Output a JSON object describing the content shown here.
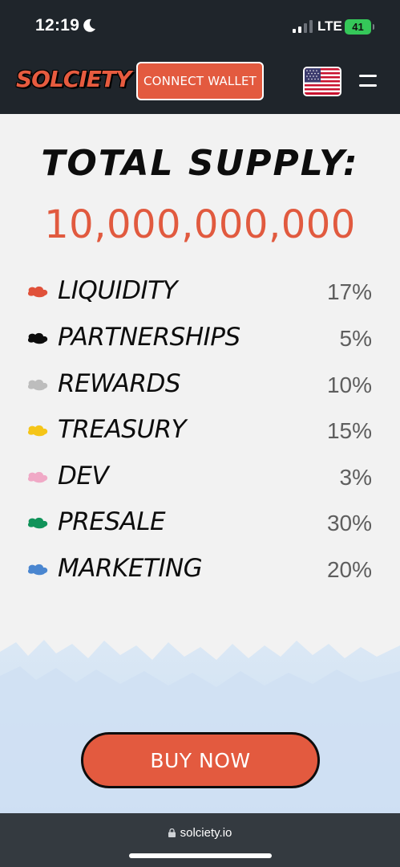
{
  "status_bar": {
    "time": "12:19",
    "network": "LTE",
    "battery": "41"
  },
  "header": {
    "logo_text": "SOLCIETY",
    "connect_wallet_label": "CONNECT WALLET"
  },
  "tokenomics": {
    "title": "TOTAL SUPPLY:",
    "supply": "10,000,000,000",
    "allocations": [
      {
        "label": "LIQUIDITY",
        "percent": "17%",
        "color": "#e0513a"
      },
      {
        "label": "PARTNERSHIPS",
        "percent": "5%",
        "color": "#0d0d0d"
      },
      {
        "label": "REWARDS",
        "percent": "10%",
        "color": "#bdbdbd"
      },
      {
        "label": "TREASURY",
        "percent": "15%",
        "color": "#f5c518"
      },
      {
        "label": "DEV",
        "percent": "3%",
        "color": "#f0a9c6"
      },
      {
        "label": "PRESALE",
        "percent": "30%",
        "color": "#11935a"
      },
      {
        "label": "MARKETING",
        "percent": "20%",
        "color": "#4a86d0"
      }
    ]
  },
  "buy_button_label": "BUY NOW",
  "browser": {
    "url": "solciety.io"
  },
  "colors": {
    "accent": "#e35a3f",
    "header_bg": "#1f252b",
    "page_bg": "#f2f2f2"
  }
}
